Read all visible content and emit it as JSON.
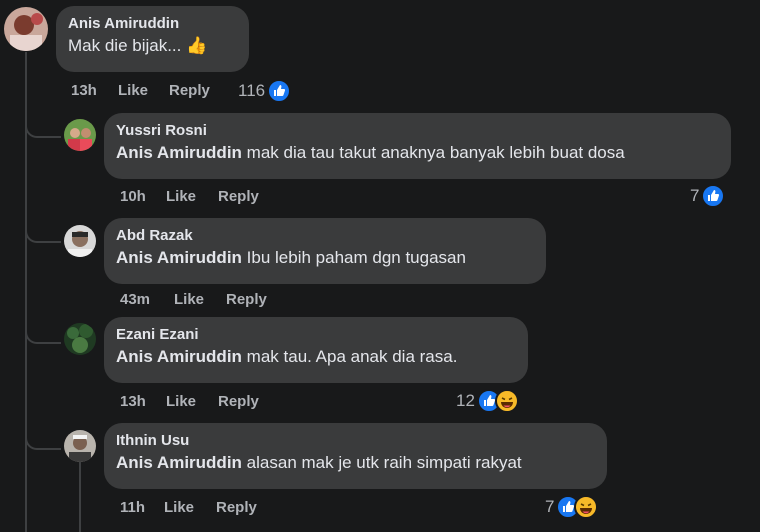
{
  "comments": [
    {
      "author": "Anis Amiruddin",
      "mention": "",
      "text": "Mak die bijak...",
      "emoji": "👍",
      "time": "13h",
      "like_label": "Like",
      "reply_label": "Reply",
      "reaction_count": "116"
    },
    {
      "author": "Yussri Rosni",
      "mention": "Anis Amiruddin",
      "text": "mak dia tau takut anaknya banyak lebih buat dosa",
      "time": "10h",
      "like_label": "Like",
      "reply_label": "Reply",
      "reaction_count": "7"
    },
    {
      "author": "Abd Razak",
      "mention": "Anis Amiruddin",
      "text": "Ibu lebih paham dgn tugasan",
      "time": "43m",
      "like_label": "Like",
      "reply_label": "Reply",
      "reaction_count": ""
    },
    {
      "author": "Ezani Ezani",
      "mention": "Anis Amiruddin",
      "text": "mak tau. Apa anak dia rasa.",
      "time": "13h",
      "like_label": "Like",
      "reply_label": "Reply",
      "reaction_count": "12"
    },
    {
      "author": "Ithnin Usu",
      "mention": "Anis Amiruddin",
      "text": "alasan mak je utk raih simpati rakyat",
      "time": "11h",
      "like_label": "Like",
      "reply_label": "Reply",
      "reaction_count": "7"
    }
  ],
  "colors": {
    "background": "#18191a",
    "bubble": "#3a3b3c",
    "like_blue": "#1877f2",
    "haha_yellow": "#f7b928",
    "secondary_text": "#b0b3b8"
  },
  "icons": [
    "thumbs-up-emoji",
    "like-reaction-icon",
    "haha-reaction-icon"
  ]
}
